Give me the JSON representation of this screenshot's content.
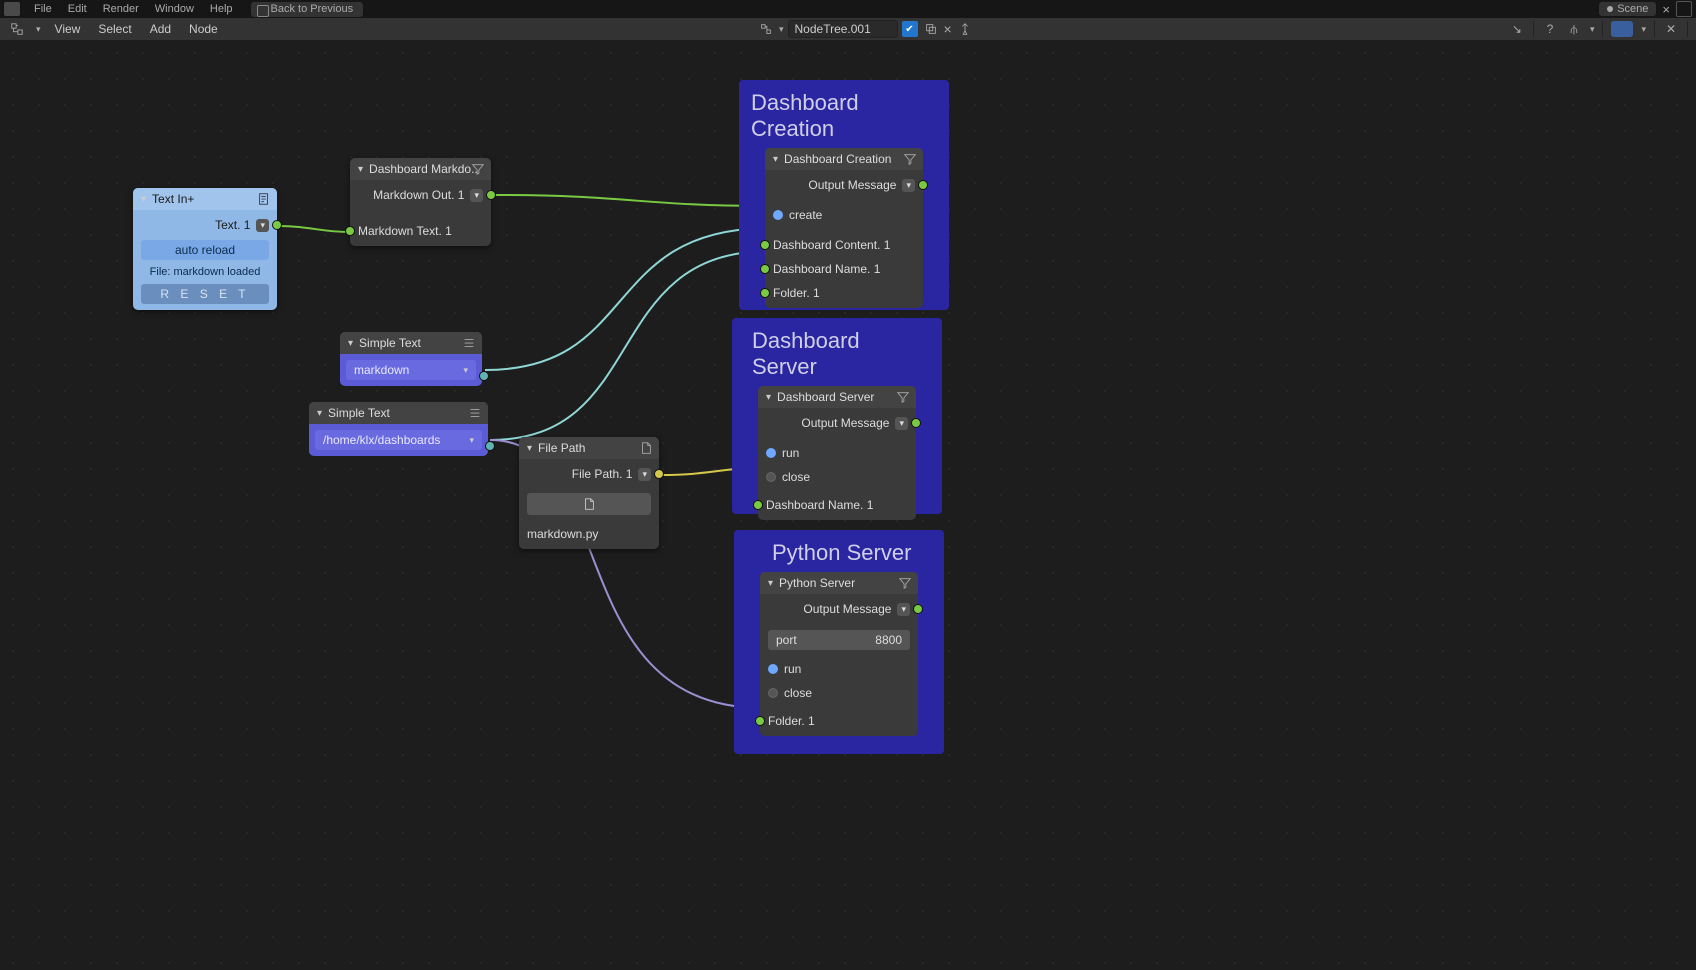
{
  "topbar": {
    "menus": [
      "File",
      "Edit",
      "Render",
      "Window",
      "Help"
    ],
    "back_label": "Back to Previous",
    "scene_label": "Scene"
  },
  "headerbar": {
    "menus": [
      "View",
      "Select",
      "Add",
      "Node"
    ],
    "nodetree_label": "NodeTree.001"
  },
  "nodes": {
    "text_in": {
      "title": "Text In+",
      "output_label": "Text. 1",
      "auto_reload": "auto reload",
      "status": "File: markdown loaded",
      "reset": "R E S E T"
    },
    "dashboard_markdown": {
      "title": "Dashboard Markdo..",
      "out_label": "Markdown Out. 1",
      "in_label": "Markdown Text. 1"
    },
    "simple_text_1": {
      "title": "Simple Text",
      "value": "markdown"
    },
    "simple_text_2": {
      "title": "Simple Text",
      "value": "/home/klx/dashboards"
    },
    "file_path": {
      "title": "File Path",
      "out_label": "File Path. 1",
      "value": "markdown.py"
    },
    "dashboard_creation": {
      "frame_title": "Dashboard Creation",
      "title": "Dashboard Creation",
      "out_label": "Output Message",
      "create_label": "create",
      "in1": "Dashboard Content. 1",
      "in2": "Dashboard Name. 1",
      "in3": "Folder. 1"
    },
    "dashboard_server": {
      "frame_title": "Dashboard Server",
      "title": "Dashboard Server",
      "out_label": "Output Message",
      "run_label": "run",
      "close_label": "close",
      "in1": "Dashboard Name. 1"
    },
    "python_server": {
      "frame_title": "Python Server",
      "title": "Python Server",
      "out_label": "Output Message",
      "port_label": "port",
      "port_value": "8800",
      "run_label": "run",
      "close_label": "close",
      "in1": "Folder. 1"
    }
  }
}
